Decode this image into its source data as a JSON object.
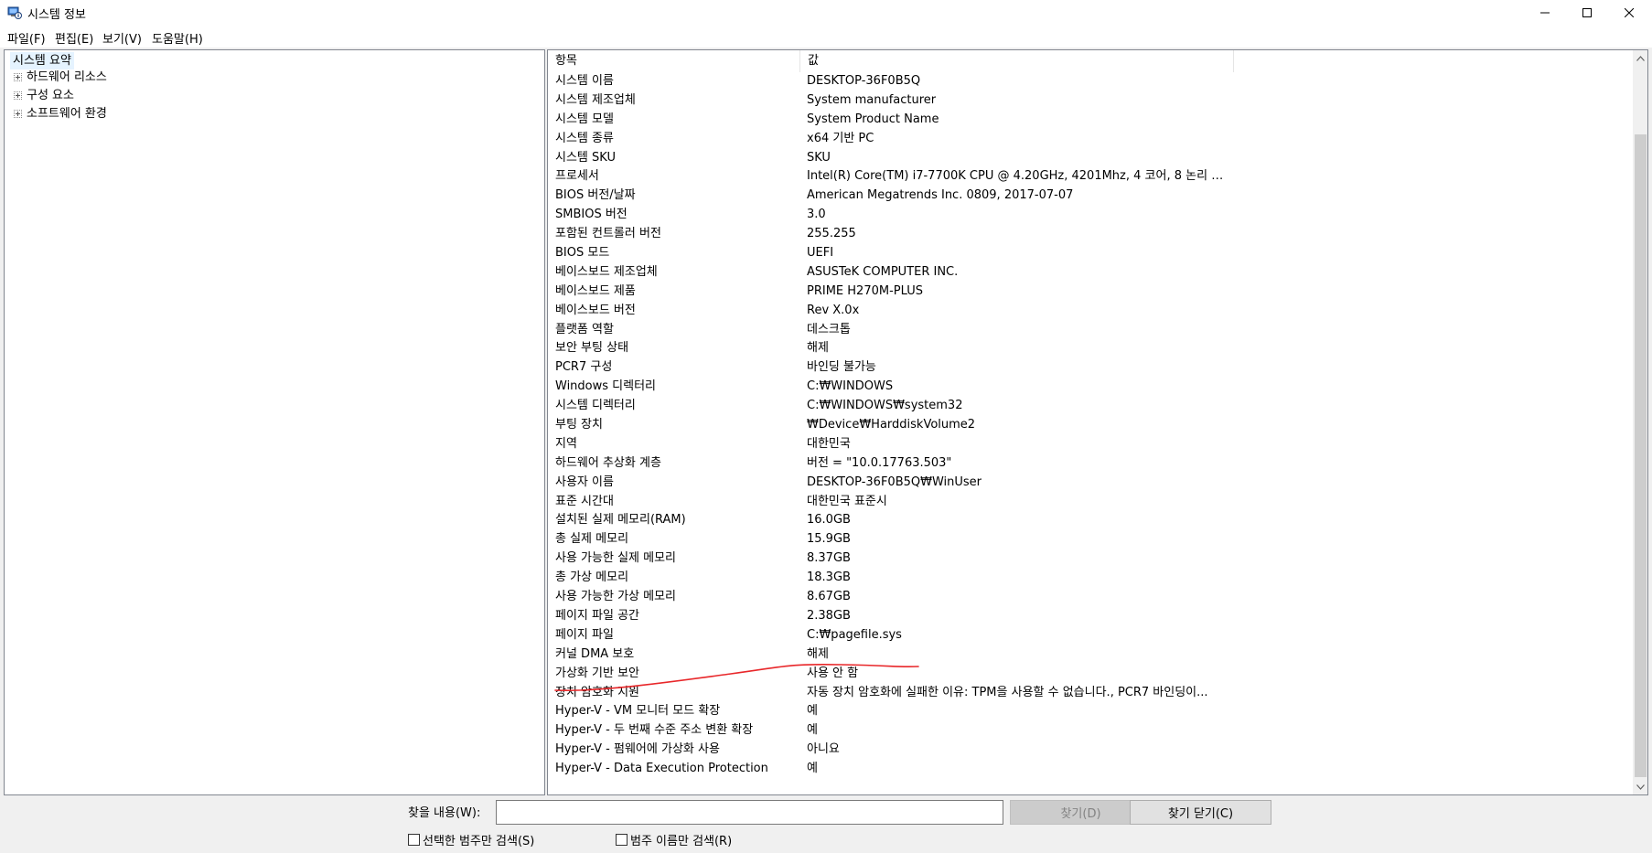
{
  "window": {
    "title": "시스템 정보",
    "icon": "system-info-icon"
  },
  "menu": [
    {
      "label": "파일(F)"
    },
    {
      "label": "편집(E)"
    },
    {
      "label": "보기(V)"
    },
    {
      "label": "도움말(H)"
    }
  ],
  "tree": {
    "root": "시스템 요약",
    "children": [
      {
        "label": "하드웨어 리소스"
      },
      {
        "label": "구성 요소"
      },
      {
        "label": "소프트웨어 환경"
      }
    ]
  },
  "list": {
    "headers": [
      "항목",
      "값",
      ""
    ],
    "rows": [
      {
        "name": "시스템 이름",
        "value": "DESKTOP-36F0B5Q"
      },
      {
        "name": "시스템 제조업체",
        "value": "System manufacturer"
      },
      {
        "name": "시스템 모델",
        "value": "System Product Name"
      },
      {
        "name": "시스템 종류",
        "value": "x64 기반 PC"
      },
      {
        "name": "시스템 SKU",
        "value": "SKU"
      },
      {
        "name": "프로세서",
        "value": "Intel(R) Core(TM) i7-7700K CPU @ 4.20GHz, 4201Mhz, 4 코어, 8 논리 프로..."
      },
      {
        "name": "BIOS 버전/날짜",
        "value": "American Megatrends Inc. 0809, 2017-07-07"
      },
      {
        "name": "SMBIOS 버전",
        "value": "3.0"
      },
      {
        "name": "포함된 컨트롤러 버전",
        "value": "255.255"
      },
      {
        "name": "BIOS 모드",
        "value": "UEFI"
      },
      {
        "name": "베이스보드 제조업체",
        "value": "ASUSTeK COMPUTER INC."
      },
      {
        "name": "베이스보드 제품",
        "value": "PRIME H270M-PLUS"
      },
      {
        "name": "베이스보드 버전",
        "value": "Rev X.0x"
      },
      {
        "name": "플랫폼 역할",
        "value": "데스크톱"
      },
      {
        "name": "보안 부팅 상태",
        "value": "해제"
      },
      {
        "name": "PCR7 구성",
        "value": "바인딩 불가능"
      },
      {
        "name": "Windows 디렉터리",
        "value": "C:₩WINDOWS"
      },
      {
        "name": "시스템 디렉터리",
        "value": "C:₩WINDOWS₩system32"
      },
      {
        "name": "부팅 장치",
        "value": "₩Device₩HarddiskVolume2"
      },
      {
        "name": "지역",
        "value": "대한민국"
      },
      {
        "name": "하드웨어 추상화 계층",
        "value": "버전 = \"10.0.17763.503\""
      },
      {
        "name": "사용자 이름",
        "value": "DESKTOP-36F0B5Q₩WinUser"
      },
      {
        "name": "표준 시간대",
        "value": "대한민국 표준시"
      },
      {
        "name": "설치된 실제 메모리(RAM)",
        "value": "16.0GB"
      },
      {
        "name": "총 실제 메모리",
        "value": "15.9GB"
      },
      {
        "name": "사용 가능한 실제 메모리",
        "value": "8.37GB"
      },
      {
        "name": "총 가상 메모리",
        "value": "18.3GB"
      },
      {
        "name": "사용 가능한 가상 메모리",
        "value": "8.67GB"
      },
      {
        "name": "페이지 파일 공간",
        "value": "2.38GB"
      },
      {
        "name": "페이지 파일",
        "value": "C:₩pagefile.sys"
      },
      {
        "name": "커널 DMA 보호",
        "value": "해제"
      },
      {
        "name": "가상화 기반 보안",
        "value": "사용 안 함"
      },
      {
        "name": "장치 암호화 지원",
        "value": "자동 장치 암호화에 실패한 이유: TPM을 사용할 수 없습니다., PCR7 바인딩이..."
      },
      {
        "name": "Hyper-V - VM 모니터 모드 확장",
        "value": "예"
      },
      {
        "name": "Hyper-V - 두 번째 수준 주소 변환 확장",
        "value": "예"
      },
      {
        "name": "Hyper-V - 펌웨어에 가상화 사용",
        "value": "아니요"
      },
      {
        "name": "Hyper-V - Data Execution Protection",
        "value": "예"
      }
    ]
  },
  "annotation": {
    "color": "#e8272a"
  },
  "find": {
    "label": "찾을 내용(W):",
    "value": "",
    "find_button": "찾기(D)",
    "close_button": "찾기 닫기(C)",
    "check_selected": "선택한 범주만 검색(S)",
    "check_names": "범주 이름만 검색(R)"
  }
}
